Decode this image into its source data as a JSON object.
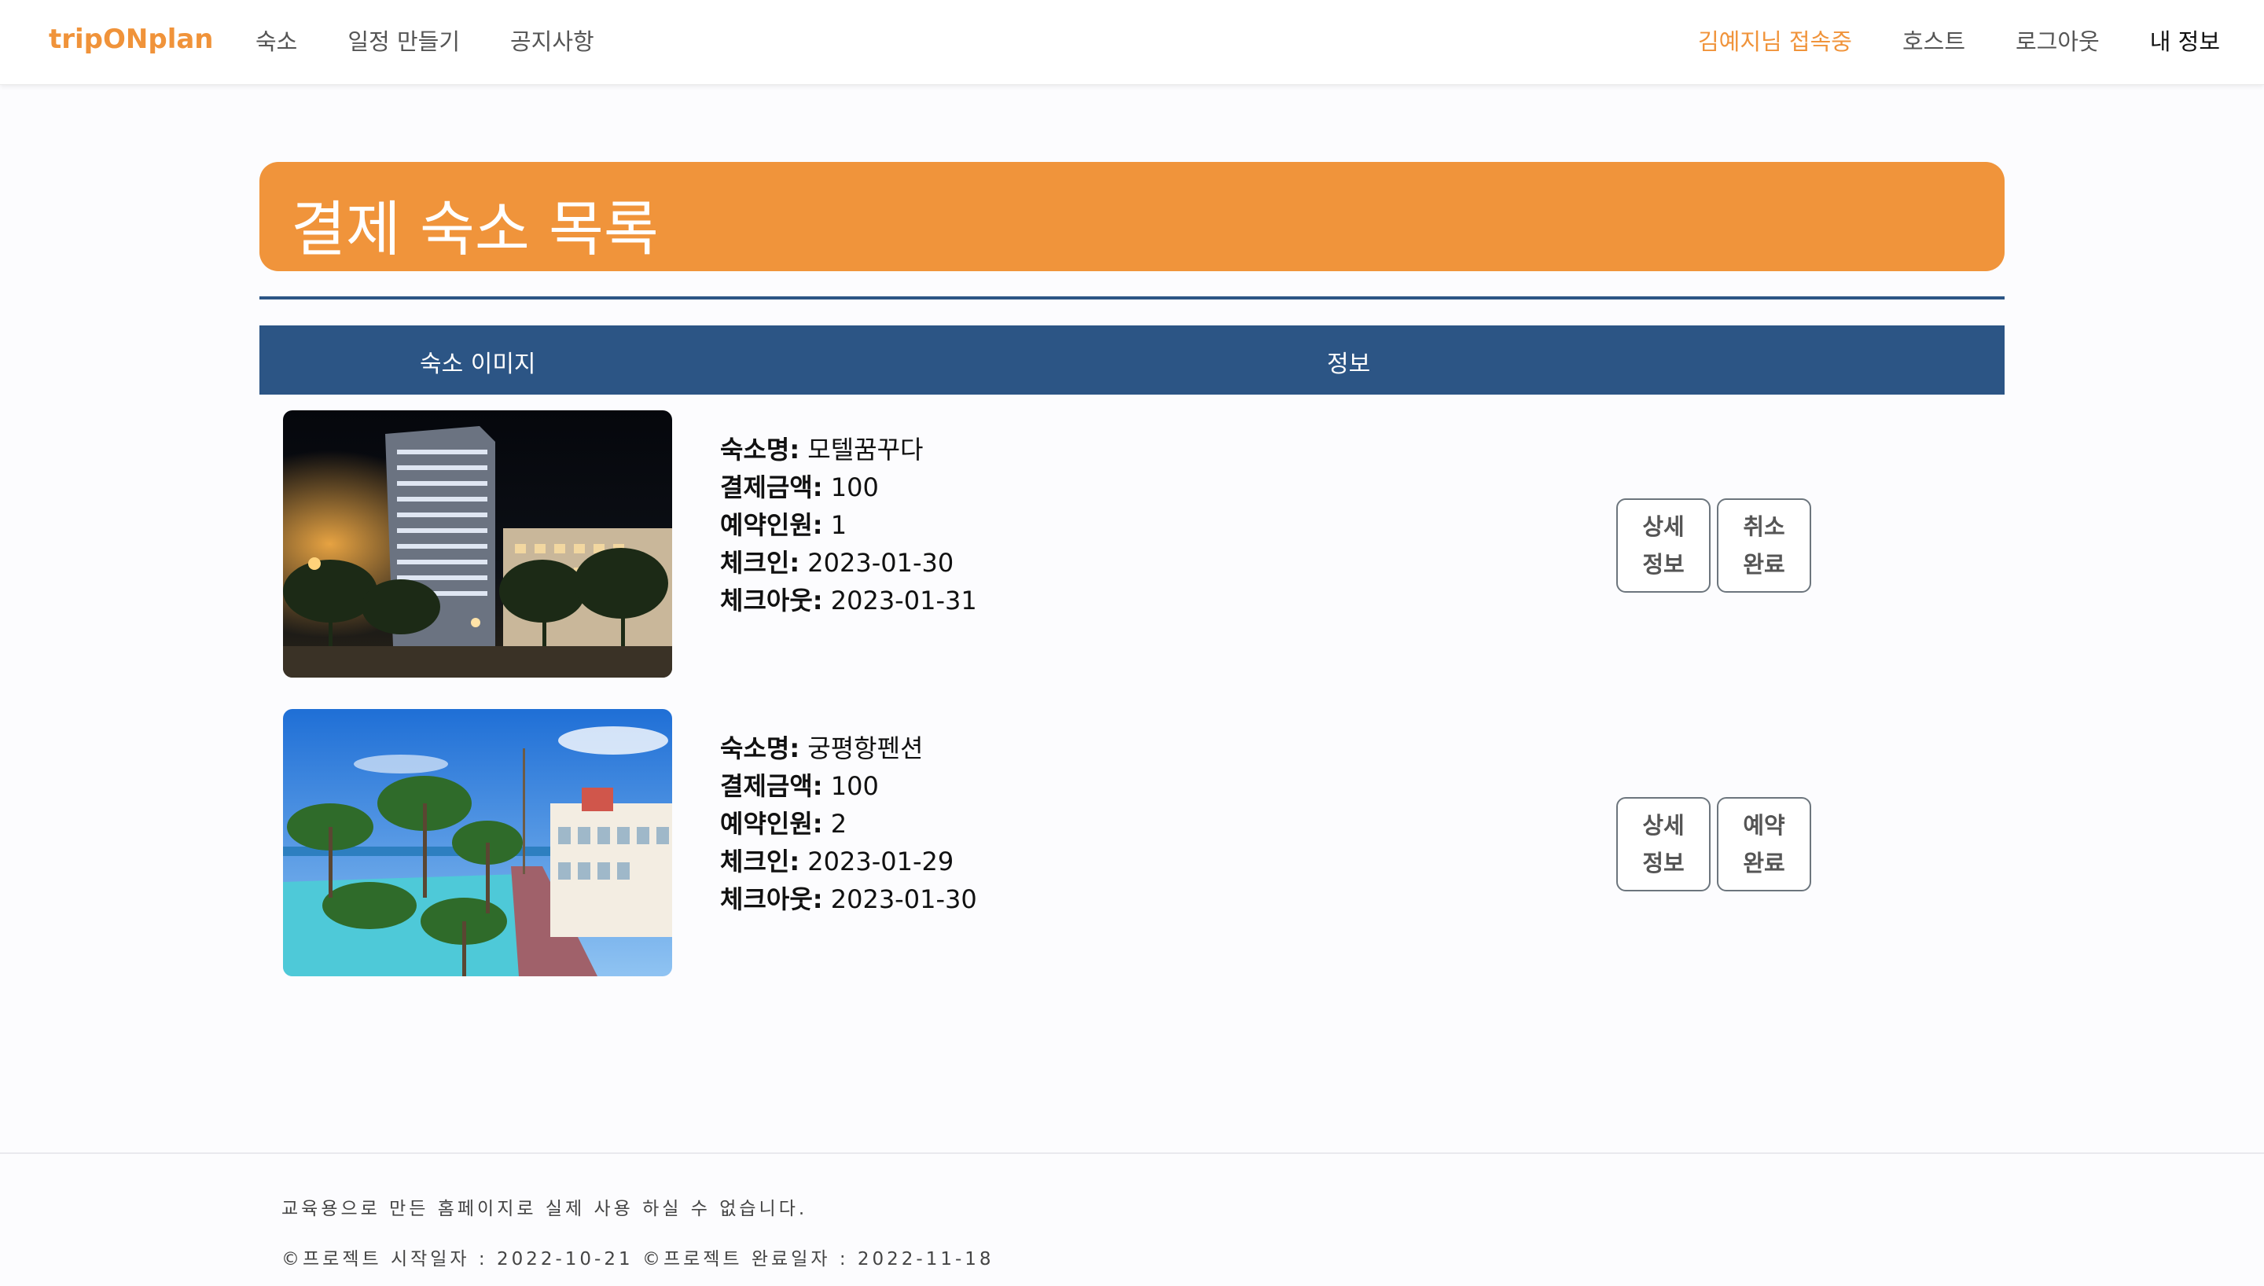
{
  "nav": {
    "brand": "tripONplan",
    "left_links": [
      "숙소",
      "일정 만들기",
      "공지사항"
    ],
    "user_status": "김예지님 접속중",
    "right_links": [
      "호스트",
      "로그아웃"
    ],
    "my_info": "내 정보"
  },
  "page": {
    "title": "결제 숙소 목록"
  },
  "table": {
    "headers": {
      "image": "숙소 이미지",
      "info": "정보"
    },
    "field_labels": {
      "name": "숙소명:",
      "amount": "결제금액:",
      "guests": "예약인원:",
      "checkin": "체크인:",
      "checkout": "체크아웃:"
    },
    "rows": [
      {
        "name": "모텔꿈꾸다",
        "amount": "100",
        "guests": "1",
        "checkin": "2023-01-30",
        "checkout": "2023-01-31",
        "detail_line1": "상세",
        "detail_line2": "정보",
        "status_line1": "취소",
        "status_line2": "완료"
      },
      {
        "name": "궁평항펜션",
        "amount": "100",
        "guests": "2",
        "checkin": "2023-01-29",
        "checkout": "2023-01-30",
        "detail_line1": "상세",
        "detail_line2": "정보",
        "status_line1": "예약",
        "status_line2": "완료"
      }
    ]
  },
  "footer": {
    "line1": "교육용으로 만든 홈페이지로 실제 사용 하실 수 없습니다.",
    "line2": "©프로젝트 시작일자 : 2022-10-21 ©프로젝트 완료일자 : 2022-11-18"
  },
  "colors": {
    "accent": "#f0943b",
    "header_blue": "#2c5585"
  }
}
